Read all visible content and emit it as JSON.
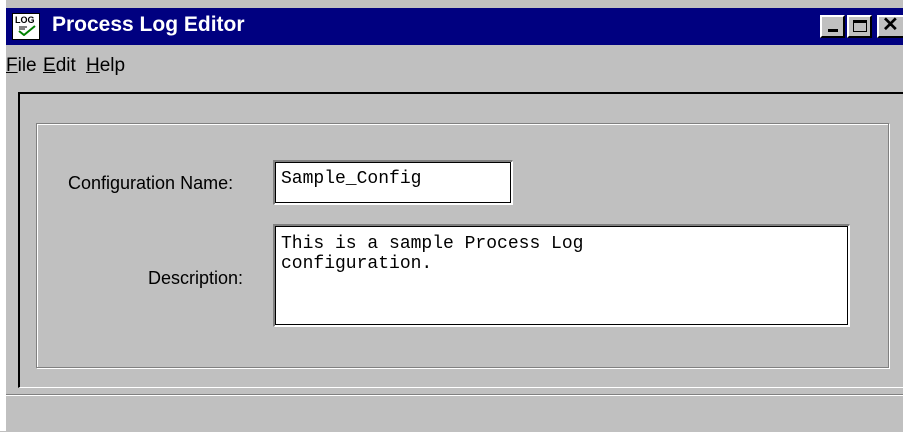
{
  "window": {
    "title": "Process Log Editor",
    "icon_label": "LOG",
    "icon": "process-log-app-icon",
    "caption_buttons": {
      "minimize": "minimize-icon",
      "maximize": "maximize-icon",
      "close": "close-icon"
    }
  },
  "menu": {
    "items": [
      {
        "label_hot": "F",
        "label_rest": "ile"
      },
      {
        "label_hot": "E",
        "label_rest": "dit"
      },
      {
        "label_hot": "H",
        "label_rest": "elp"
      }
    ]
  },
  "form": {
    "config_name_label": "Configuration Name:",
    "config_name_value": "Sample_Config",
    "description_label": "Description:",
    "description_value": "This is a sample Process Log\nconfiguration."
  },
  "colors": {
    "titlebar": "#000080",
    "face": "#c0c0c0"
  }
}
